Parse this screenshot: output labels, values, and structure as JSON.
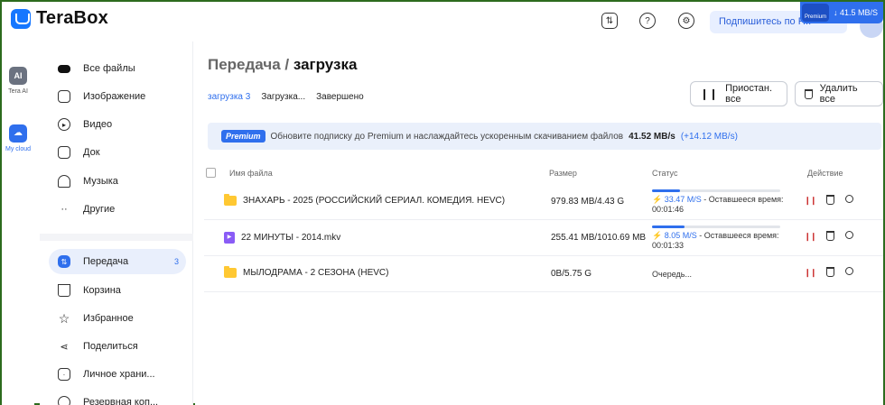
{
  "app": {
    "title": "TeraBox",
    "subscribe_label": "Подпишитесь по Р...",
    "speed_badge": "↓ 41.5 MB/S",
    "premium_small": "Premium"
  },
  "rail": {
    "ai_label": "Tera AI",
    "cloud_label": "My cloud"
  },
  "sidebar": {
    "items": [
      {
        "label": "Все файлы",
        "icon": "all-files-icon"
      },
      {
        "label": "Изображение",
        "icon": "image-icon"
      },
      {
        "label": "Видео",
        "icon": "video-icon"
      },
      {
        "label": "Док",
        "icon": "doc-icon"
      },
      {
        "label": "Музыка",
        "icon": "music-icon"
      },
      {
        "label": "Другие",
        "icon": "other-icon"
      },
      {
        "label": "Передача",
        "icon": "transfer-icon",
        "count": "3"
      },
      {
        "label": "Корзина",
        "icon": "trash-icon"
      },
      {
        "label": "Избранное",
        "icon": "star-icon"
      },
      {
        "label": "Поделиться",
        "icon": "share-icon"
      },
      {
        "label": "Личное храни...",
        "icon": "vault-icon"
      },
      {
        "label": "Резервная коп...",
        "icon": "backup-icon"
      }
    ]
  },
  "main": {
    "title_part1": "Передача",
    "title_sep": " / ",
    "title_part2": "загрузка",
    "tabs": [
      "загрузка 3",
      "Загрузка...",
      "Завершено"
    ],
    "pause_all": "Приостан. все",
    "delete_all": "Удалить все",
    "banner": {
      "tag": "Premium",
      "text": "Обновите подписку до Premium и наслаждайтесь ускоренным скачиванием файлов",
      "speed": "41.52 MB/s",
      "plus": "(+14.12 MB/s)"
    },
    "columns": [
      "Имя файла",
      "Размер",
      "Статус",
      "Действие"
    ],
    "rows": [
      {
        "name": "ЗНАХАРЬ - 2025 (РОССИЙСКИЙ СЕРИАЛ. КОМЕДИЯ. HEVC)",
        "type": "folder",
        "size": "979.83 MB/4.43 G",
        "progress": 0.22,
        "rate": "33.47 M/S",
        "remaining": "- Оставшееся время:",
        "time": "00:01:46"
      },
      {
        "name": "22 МИНУТЫ - 2014.mkv",
        "type": "video",
        "size": "255.41 MB/1010.69 MB",
        "progress": 0.25,
        "rate": "8.05 M/S",
        "remaining": "- Оставшееся время: 00:01:33",
        "time": ""
      },
      {
        "name": "МЫЛОДРАМА - 2 СЕЗОНА (HEVC)",
        "type": "folder",
        "size": "0B/5.75 G",
        "progress": 0,
        "rate": "",
        "remaining": "",
        "time": "Очередь..."
      }
    ]
  },
  "colors": {
    "accent": "#2f6fed",
    "folder": "#ffc832",
    "video": "#8a5cf6"
  }
}
